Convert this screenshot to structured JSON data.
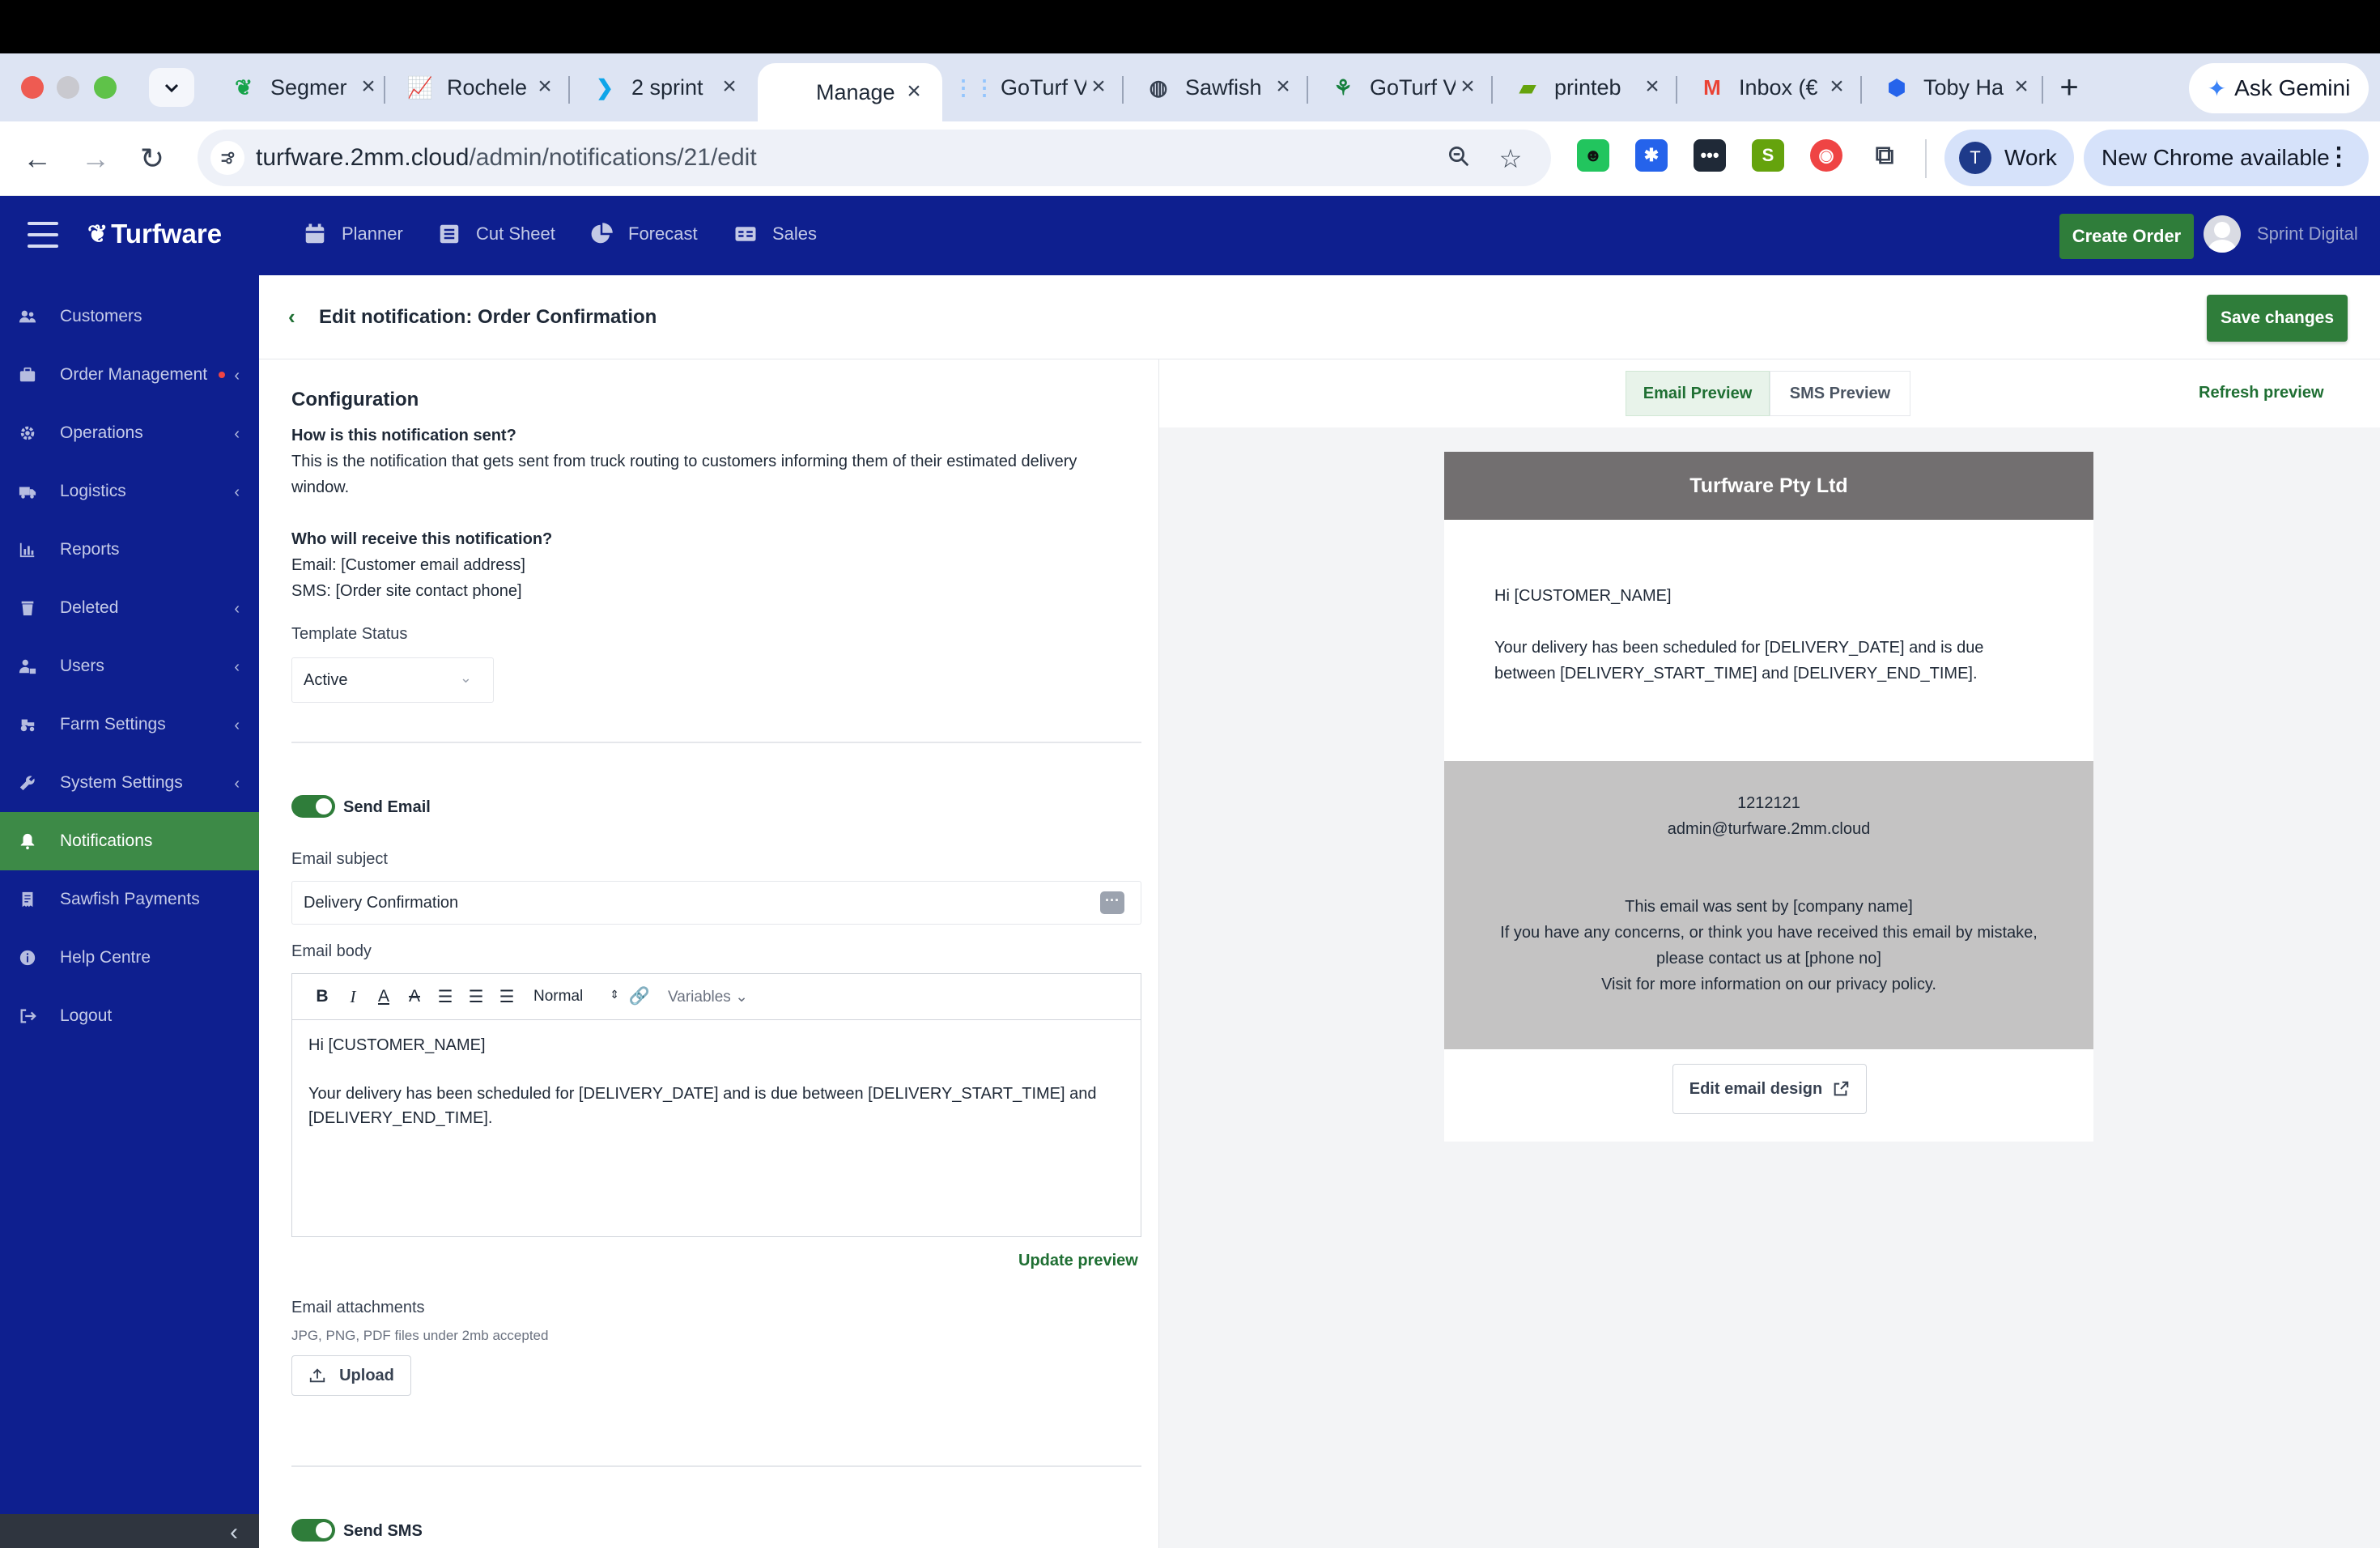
{
  "browser": {
    "tabs": [
      {
        "title": "Segmer",
        "icon": "segment-icon",
        "color": "#16a34a",
        "glyph": "❦"
      },
      {
        "title": "Rochele",
        "icon": "chart-icon",
        "color": "#dc2626",
        "glyph": "📈"
      },
      {
        "title": "2 sprint",
        "icon": "chevron-icon",
        "color": "#0ea5e9",
        "glyph": "❯"
      },
      {
        "title": "Manage",
        "icon": "turfware-icon",
        "color": "#ffffff",
        "glyph": ""
      },
      {
        "title": "GoTurf V",
        "icon": "goturf-icon",
        "color": "#93c5fd",
        "glyph": "⋮⋮"
      },
      {
        "title": "Sawfish",
        "icon": "globe-icon",
        "color": "#374151",
        "glyph": "🌐"
      },
      {
        "title": "GoTurf V",
        "icon": "goturf-logo-icon",
        "color": "#15803d",
        "glyph": "⚘"
      },
      {
        "title": "printeb",
        "icon": "shopify-icon",
        "color": "#65a30d",
        "glyph": "🛍"
      },
      {
        "title": "Inbox (€",
        "icon": "gmail-icon",
        "color": "#ea4335",
        "glyph": "M"
      },
      {
        "title": "Toby Ha",
        "icon": "hexagon-icon",
        "color": "#2563eb",
        "glyph": "⬢"
      }
    ],
    "ask_gemini": "Ask Gemini",
    "url_host": "turfware.2mm.cloud",
    "url_path": "/admin/notifications/21/edit",
    "profile_initial": "T",
    "profile_label": "Work",
    "update_label": "New Chrome available"
  },
  "app": {
    "brand": "Turfware",
    "topnav": [
      {
        "label": "Planner",
        "icon": "calendar-icon"
      },
      {
        "label": "Cut Sheet",
        "icon": "list-icon"
      },
      {
        "label": "Forecast",
        "icon": "pie-chart-icon"
      },
      {
        "label": "Sales",
        "icon": "sales-icon"
      }
    ],
    "create_order": "Create Order",
    "user_name": "Sprint Digital"
  },
  "sidebar": {
    "items": [
      {
        "label": "Customers",
        "icon": "users-icon",
        "chevron": false
      },
      {
        "label": "Order Management",
        "icon": "briefcase-icon",
        "chevron": true,
        "dot": true
      },
      {
        "label": "Operations",
        "icon": "cog-icon",
        "chevron": true
      },
      {
        "label": "Logistics",
        "icon": "truck-icon",
        "chevron": true
      },
      {
        "label": "Reports",
        "icon": "bar-chart-icon",
        "chevron": false
      },
      {
        "label": "Deleted",
        "icon": "trash-icon",
        "chevron": true
      },
      {
        "label": "Users",
        "icon": "user-lock-icon",
        "chevron": true
      },
      {
        "label": "Farm Settings",
        "icon": "tractor-icon",
        "chevron": true
      },
      {
        "label": "System Settings",
        "icon": "wrench-icon",
        "chevron": true
      },
      {
        "label": "Notifications",
        "icon": "bell-icon",
        "chevron": false,
        "active": true
      },
      {
        "label": "Sawfish Payments",
        "icon": "receipt-icon",
        "chevron": false
      },
      {
        "label": "Help Centre",
        "icon": "info-icon",
        "chevron": false
      },
      {
        "label": "Logout",
        "icon": "logout-icon",
        "chevron": false
      }
    ]
  },
  "page": {
    "title": "Edit notification: Order Confirmation",
    "save_label": "Save changes"
  },
  "config": {
    "heading": "Configuration",
    "how_q": "How is this notification sent?",
    "how_a_line1": "This is the notification that gets sent from truck routing to customers informing them of their estimated delivery",
    "how_a_line2": "window.",
    "who_q": "Who will receive this notification?",
    "who_email": "Email: [Customer email address]",
    "who_sms": "SMS: [Order site contact phone]",
    "template_status_label": "Template Status",
    "template_status_value": "Active",
    "send_email_label": "Send Email",
    "email_subject_label": "Email subject",
    "email_subject_value": "Delivery Confirmation",
    "email_body_label": "Email body",
    "format_value": "Normal",
    "variables_label": "Variables",
    "body_line1": "Hi [CUSTOMER_NAME]",
    "body_line2": "Your delivery has been scheduled for [DELIVERY_DATE] and is due between [DELIVERY_START_TIME] and",
    "body_line3": "[DELIVERY_END_TIME].",
    "update_preview": "Update preview",
    "attachments_label": "Email attachments",
    "attachments_hint": "JPG, PNG, PDF files under 2mb accepted",
    "upload_label": "Upload",
    "send_sms_label": "Send SMS"
  },
  "preview": {
    "email_tab": "Email Preview",
    "sms_tab": "SMS Preview",
    "refresh": "Refresh preview",
    "company": "Turfware Pty Ltd",
    "greeting": "Hi [CUSTOMER_NAME]",
    "body_line1": "Your delivery has been scheduled for [DELIVERY_DATE] and is due",
    "body_line2": "between [DELIVERY_START_TIME] and [DELIVERY_END_TIME].",
    "footer_phone": "1212121",
    "footer_email": "admin@turfware.2mm.cloud",
    "footer_sent_by": "This email was sent by [company name]",
    "footer_concerns": "If you have any concerns, or think you have received this email by mistake,",
    "footer_contact": "please contact us at [phone no]",
    "footer_privacy": "Visit for more information on our privacy policy.",
    "edit_design": "Edit email design"
  }
}
